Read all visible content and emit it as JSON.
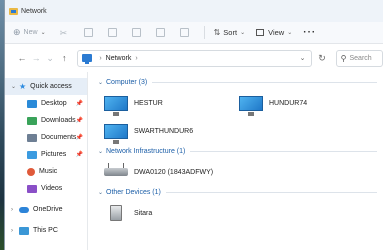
{
  "window": {
    "title": "Network"
  },
  "colors": {
    "accent": "#1d5fa8",
    "selection": "#e6eef7"
  },
  "toolbar": {
    "new_label": "New",
    "sort_label": "Sort",
    "view_label": "View",
    "more_label": "···"
  },
  "address": {
    "crumb": "Network",
    "search_placeholder": "Search"
  },
  "sidebar": {
    "items": [
      {
        "label": "Quick access",
        "icon": "star-icon"
      },
      {
        "label": "Desktop",
        "icon": "desktop-folder-icon"
      },
      {
        "label": "Downloads",
        "icon": "downloads-folder-icon"
      },
      {
        "label": "Documents",
        "icon": "documents-folder-icon"
      },
      {
        "label": "Pictures",
        "icon": "pictures-folder-icon"
      },
      {
        "label": "Music",
        "icon": "music-folder-icon"
      },
      {
        "label": "Videos",
        "icon": "videos-folder-icon"
      },
      {
        "label": "OneDrive",
        "icon": "onedrive-cloud-icon"
      },
      {
        "label": "This PC",
        "icon": "this-pc-icon"
      }
    ]
  },
  "groups": [
    {
      "header": "Computer (3)",
      "items": [
        "HESTUR",
        "HUNDUR74",
        "SWARTHUNDUR6"
      ]
    },
    {
      "header": "Network Infrastructure (1)",
      "items": [
        "DWA0120 (1843ADFWY)"
      ]
    },
    {
      "header": "Other Devices (1)",
      "items": [
        "Sitara"
      ]
    }
  ]
}
